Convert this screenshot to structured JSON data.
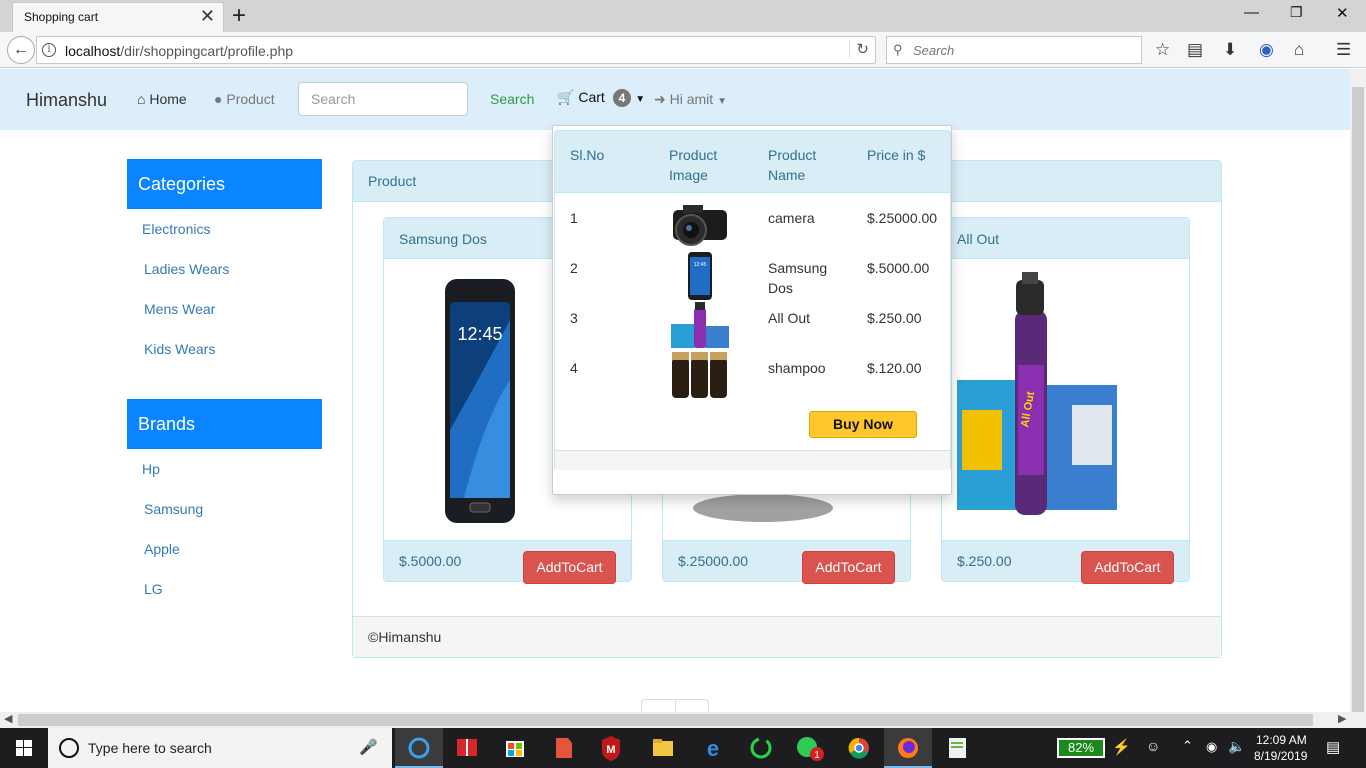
{
  "browser": {
    "tab_title": "Shopping cart",
    "tab_close": "✕",
    "new_tab": "+",
    "url_host": "localhost",
    "url_path": "/dir/shoppingcart/profile.php",
    "search_placeholder": "Search"
  },
  "nav": {
    "brand": "Himanshu",
    "home": "Home",
    "product": "Product",
    "search_placeholder": "Search",
    "search_button": "Search",
    "cart": "Cart",
    "cart_count": "4",
    "user": "Hi amit"
  },
  "sidebar": {
    "categories_title": "Categories",
    "categories": [
      "Electronics",
      "Ladies Wears",
      "Mens Wear",
      "Kids Wears"
    ],
    "brands_title": "Brands",
    "brands": [
      "Hp",
      "Samsung",
      "Apple",
      "LG"
    ]
  },
  "panel": {
    "title": "Product",
    "footer": "©Himanshu"
  },
  "products": [
    {
      "name": "Samsung Dos",
      "price": "$.5000.00",
      "button": "AddToCart"
    },
    {
      "name": "camera",
      "price": "$.25000.00",
      "button": "AddToCart"
    },
    {
      "name": "All Out",
      "price": "$.250.00",
      "button": "AddToCart"
    }
  ],
  "cart_dropdown": {
    "headers": [
      "Sl.No",
      "Product Image",
      "Product Name",
      "Price in $"
    ],
    "rows": [
      {
        "sl": "1",
        "name": "camera",
        "price": "$.25000.00"
      },
      {
        "sl": "2",
        "name": "Samsung Dos",
        "price": "$.5000.00"
      },
      {
        "sl": "3",
        "name": "All Out",
        "price": "$.250.00"
      },
      {
        "sl": "4",
        "name": "shampoo",
        "price": "$.120.00"
      }
    ],
    "buy_button": "Buy Now"
  },
  "taskbar": {
    "search_text": "Type here to search",
    "battery": "82%",
    "time": "12:09 AM",
    "date": "8/19/2019",
    "notification_count": "1"
  }
}
